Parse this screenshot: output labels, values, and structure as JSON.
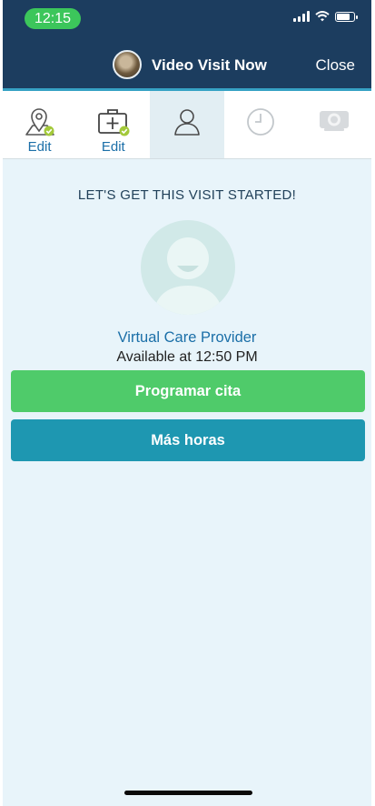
{
  "status_bar": {
    "time": "12:15"
  },
  "header": {
    "title": "Video Visit Now",
    "close_label": "Close"
  },
  "steps": [
    {
      "name": "location",
      "label": "Edit",
      "state": "completed"
    },
    {
      "name": "medical",
      "label": "Edit",
      "state": "completed"
    },
    {
      "name": "provider",
      "label": "",
      "state": "active"
    },
    {
      "name": "time",
      "label": "",
      "state": "pending"
    },
    {
      "name": "video",
      "label": "",
      "state": "pending"
    }
  ],
  "main": {
    "heading": "LET'S GET THIS VISIT STARTED!",
    "provider_name": "Virtual Care Provider",
    "availability": "Available at 12:50 PM",
    "schedule_button": "Programar cita",
    "more_times_button": "Más horas"
  },
  "colors": {
    "header_bg": "#1c3d5f",
    "accent_green": "#4fcb6a",
    "accent_teal": "#1e97b1",
    "link_blue": "#1b6fa8",
    "content_bg": "#e8f4fa"
  }
}
